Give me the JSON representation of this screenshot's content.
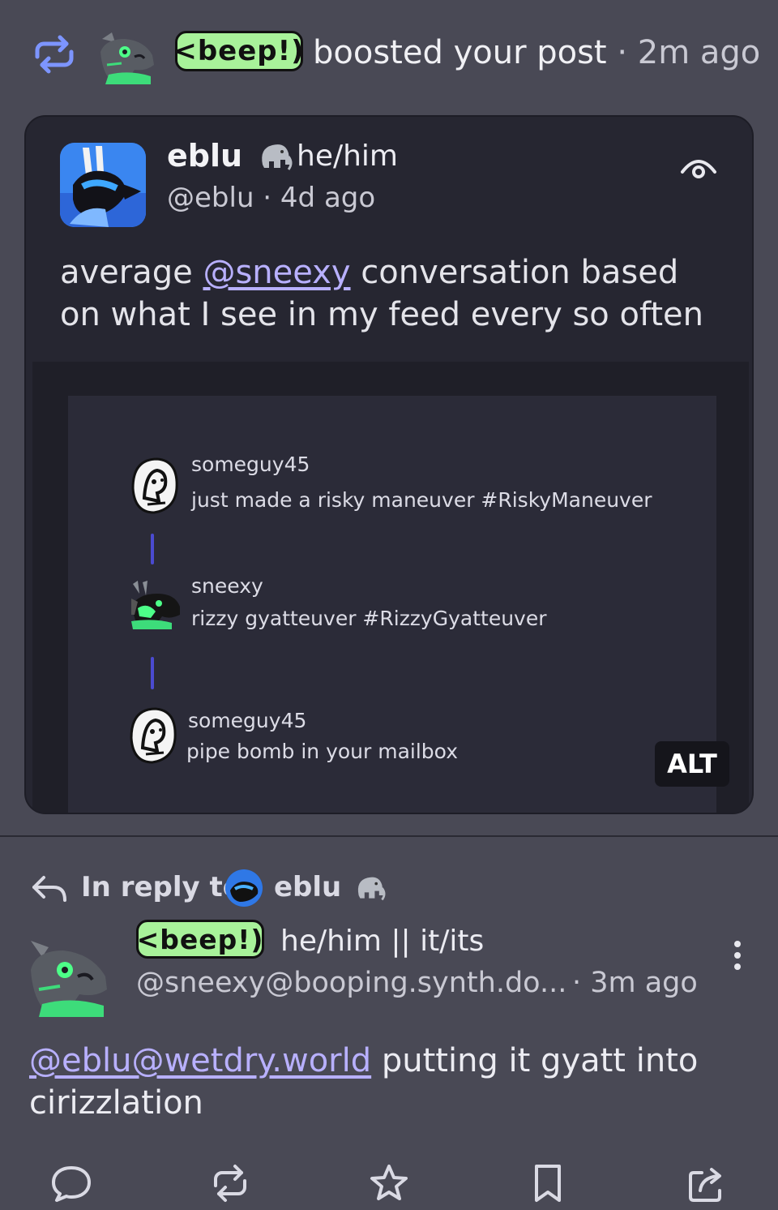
{
  "boost": {
    "avatar": "sneexy-avatar",
    "beep_tag": "<beep!)",
    "text": "boosted your post",
    "time": " · 2m ago",
    "icon": "boost-icon"
  },
  "quoted_post": {
    "name": "eblu",
    "name_icon": "mastodon-elephant",
    "pronouns": "he/him",
    "handle_time": "@eblu · 4d ago",
    "visibility_icon": "eye-icon",
    "body_pre": "average ",
    "mention": "@sneexy",
    "body_post": " conversation based on what I see in my feed every so often",
    "image": {
      "alt_badge": "ALT",
      "thread": [
        {
          "user": "someguy45",
          "text": "just made a risky maneuver #RiskyManeuver"
        },
        {
          "user": "sneexy",
          "text": "rizzy gyatteuver #RizzyGyatteuver"
        },
        {
          "user": "someguy45",
          "text": "pipe bomb in your mailbox"
        }
      ]
    }
  },
  "reply_context": {
    "label": "In reply to",
    "name": "eblu",
    "name_icon": "mastodon-elephant"
  },
  "post": {
    "beep_tag": "<beep!)",
    "pronouns": "he/him || it/its",
    "handle": "@sneexy@booping.synth.do...",
    "time": "· 3m ago",
    "mention": "@eblu@wetdry.world",
    "body": " putting it gyatt into cirizzlation"
  },
  "actions": [
    "reply-icon",
    "boost-icon",
    "favourite-icon",
    "bookmark-icon",
    "share-icon"
  ],
  "colors": {
    "background": "#494955",
    "card": "#262631",
    "accent_mention": "#b8b0ff",
    "beep_green": "#a8f29a",
    "boost_blue": "#6f8cff"
  }
}
